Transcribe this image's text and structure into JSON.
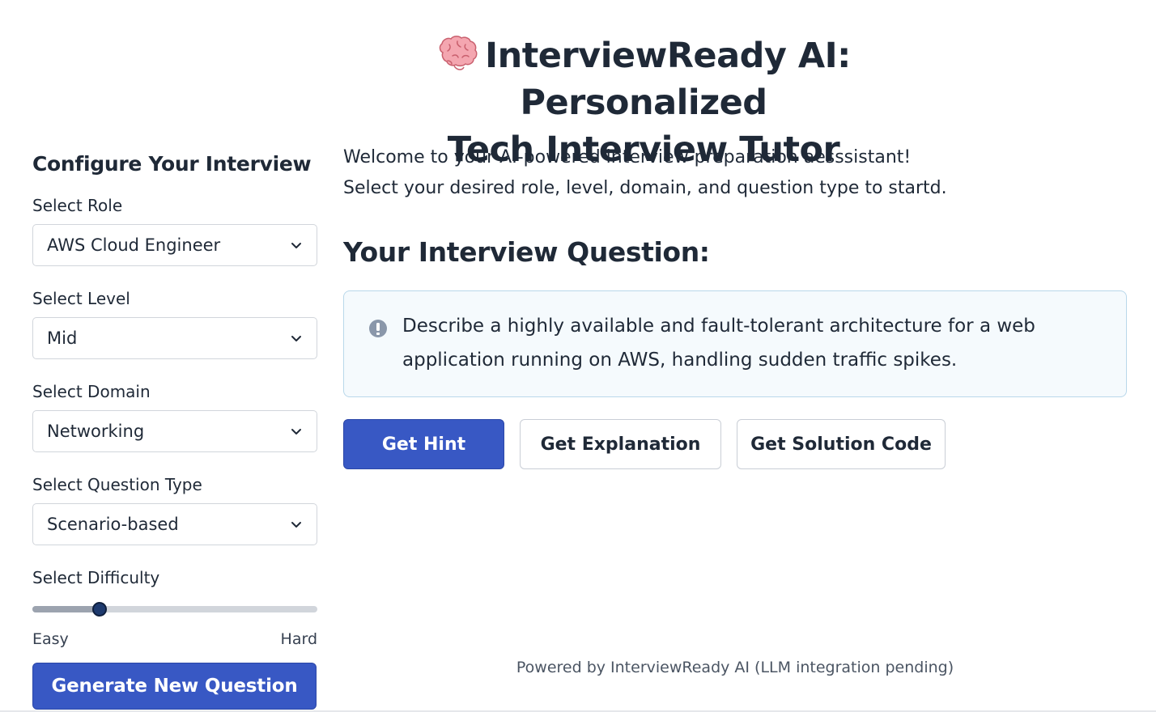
{
  "header": {
    "icon": "brain-icon",
    "title_line1": "InterviewReady AI: Personalized",
    "title_line2": "Tech Interview Tutor"
  },
  "sidebar": {
    "title": "Configure Your Interview",
    "role": {
      "label": "Select Role",
      "value": "AWS Cloud Engineer"
    },
    "level": {
      "label": "Select Level",
      "value": "Mid"
    },
    "domain": {
      "label": "Select Domain",
      "value": "Networking"
    },
    "question_type": {
      "label": "Select Question Type",
      "value": "Scenario-based"
    },
    "difficulty": {
      "label": "Select Difficulty",
      "min_label": "Easy",
      "max_label": "Hard",
      "value_fraction": 0.235
    },
    "generate_label": "Generate New Question"
  },
  "main": {
    "welcome_line1": "Welcome to your AI-powered interview preparation aėsssistant!",
    "welcome_line2": "Select your desired role, level, domain, and question type to startd.",
    "question_heading": "Your Interview Question:",
    "question_icon": "info-icon",
    "question_text": "Describe a highly available and fault-tolerant architecture for a web application running on AWS, handling sudden traffic spikes.",
    "buttons": {
      "hint": "Get Hint",
      "explanation": "Get Explanation",
      "solution": "Get Solution Code"
    },
    "footer": "Powered by InterviewReady AI (LLM integration pending)"
  },
  "colors": {
    "primary": "#3858c4",
    "card_bg": "#f5fafd",
    "card_border": "#b9d8ea",
    "slider_thumb": "#1e3a6e"
  }
}
